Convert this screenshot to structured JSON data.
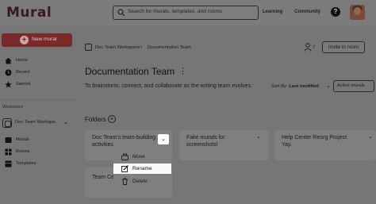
{
  "header": {
    "logo": "Mural",
    "search_placeholder": "Search for murals, templates, and rooms",
    "links": [
      "Learning",
      "Community"
    ],
    "help_label": "?"
  },
  "sidebar": {
    "new_mural_label": "New mural",
    "items": [
      {
        "label": "Home",
        "icon": "home-icon"
      },
      {
        "label": "Recent",
        "icon": "clock-icon"
      },
      {
        "label": "Starred",
        "icon": "star-icon"
      }
    ],
    "workspace_label": "Workspace",
    "workspace_name": "Doc Team Workspa...",
    "workspace_items": [
      {
        "label": "Murals",
        "icon": "murals-icon"
      },
      {
        "label": "Rooms",
        "icon": "rooms-icon"
      },
      {
        "label": "Templates",
        "icon": "templates-icon"
      }
    ]
  },
  "breadcrumb": {
    "workspace": "Doc Team Workspace",
    "separator": "›",
    "current": "Documentation Team"
  },
  "room": {
    "member_count": "7",
    "invite_label": "Invite to room",
    "title": "Documentation Team",
    "subtitle": "To brainstorm, connect, and collaborate as the writing team evolves.",
    "sort_prefix": "Sort By:",
    "sort_value": "Last modified",
    "filter_label": "Active murals"
  },
  "folders": {
    "heading": "Folders",
    "cards": [
      {
        "name_line1": "Doc Team's team-building",
        "name_line2": "activities"
      },
      {
        "name_line1": "Fake murals for",
        "name_line2": "screenshots!"
      },
      {
        "name_line1": "Help Center Reorg Project",
        "name_line2": "Yay."
      },
      {
        "name_line1": "Team Ce",
        "name_line2": ""
      }
    ]
  },
  "context_menu": {
    "items": [
      {
        "label": "Move",
        "icon": "move-icon"
      },
      {
        "label": "Rename",
        "icon": "rename-icon",
        "highlighted": true
      },
      {
        "label": "Delete",
        "icon": "trash-icon"
      }
    ]
  }
}
